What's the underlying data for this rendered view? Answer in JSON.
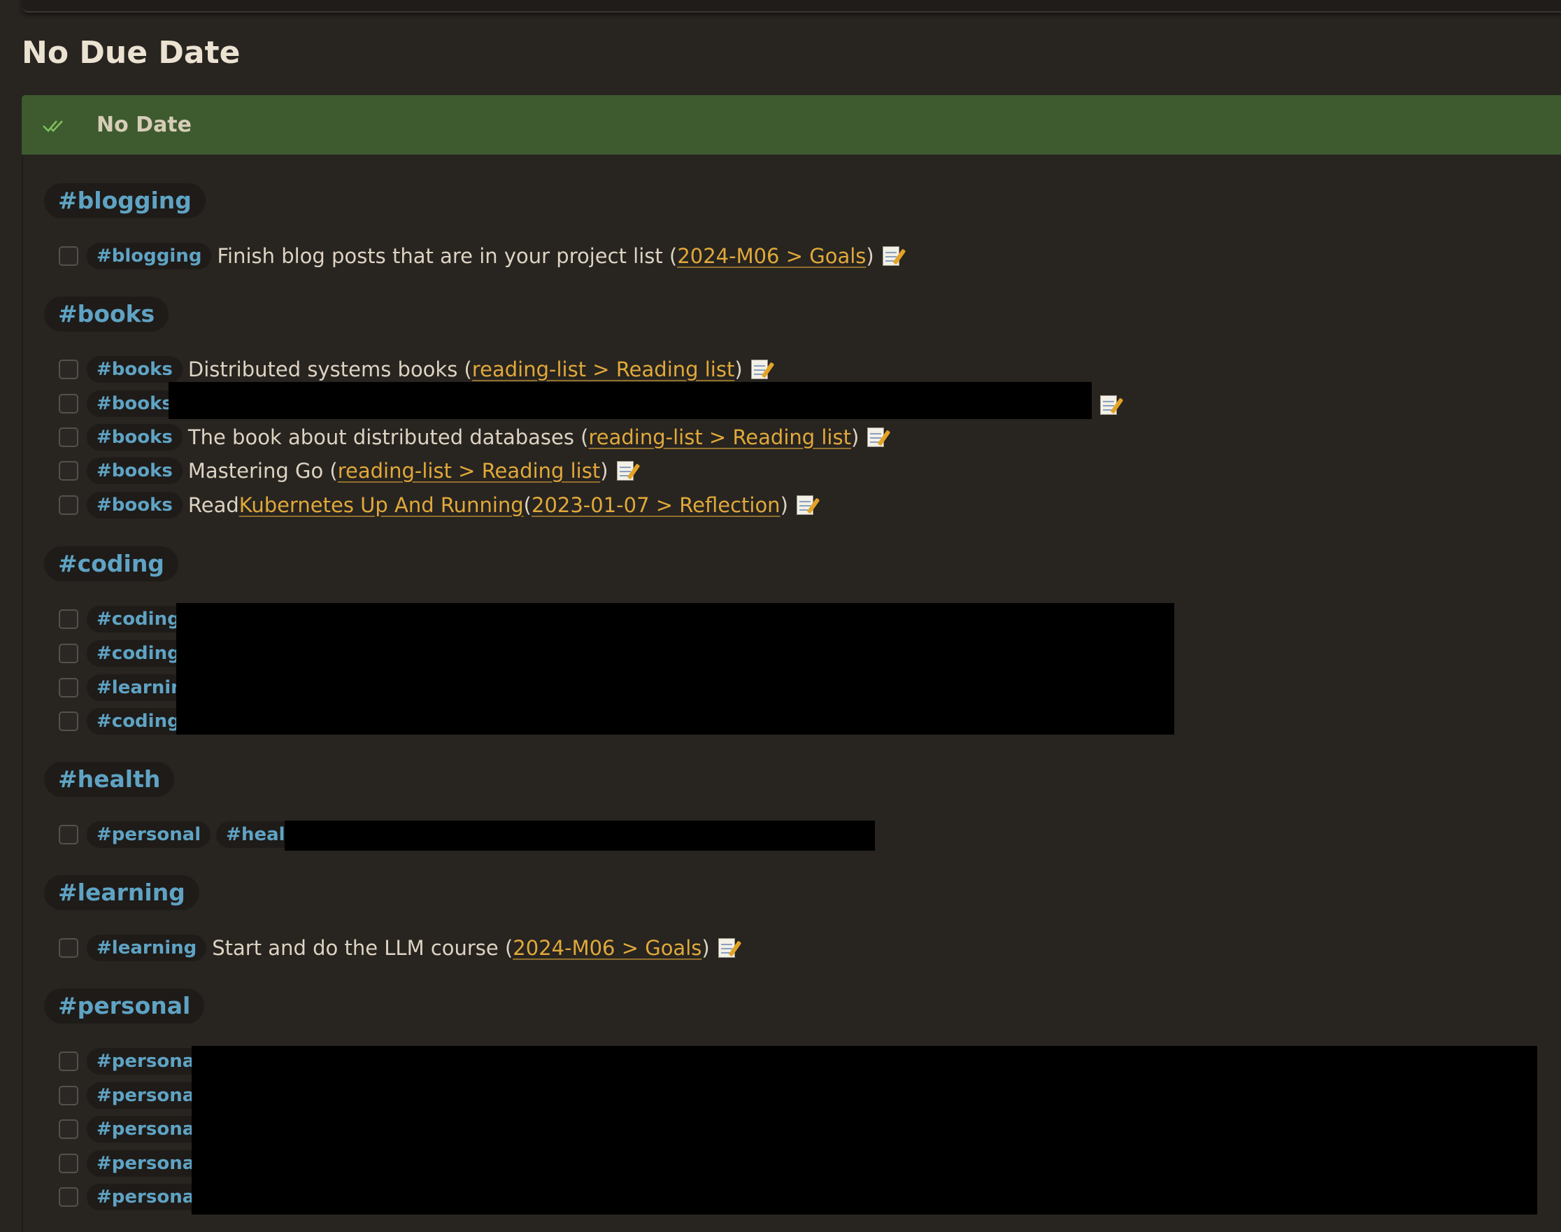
{
  "page": {
    "title": "No Due Date"
  },
  "callout": {
    "title": "No Date",
    "icon": "double-check-icon"
  },
  "groups": {
    "blogging": {
      "tag": "#blogging"
    },
    "books": {
      "tag": "#books"
    },
    "coding": {
      "tag": "#coding"
    },
    "health": {
      "tag": "#health"
    },
    "learning": {
      "tag": "#learning"
    },
    "personal": {
      "tag": "#personal"
    }
  },
  "tasks": {
    "blogging1": {
      "tag": "#blogging",
      "text": "Finish blog posts that are in your project list (",
      "link": "2024-M06 > Goals",
      "tail": ")"
    },
    "books1": {
      "tag": "#books",
      "text": "Distributed systems books (",
      "link": "reading-list > Reading list",
      "tail": ")"
    },
    "books2": {
      "tag": "#books"
    },
    "books3": {
      "tag": "#books",
      "text": "The book about distributed databases (",
      "link": "reading-list > Reading list",
      "tail": ")"
    },
    "books4": {
      "tag": "#books",
      "text": "Mastering Go (",
      "link": "reading-list > Reading list",
      "tail": ")"
    },
    "books5": {
      "tag": "#books",
      "text": "Read ",
      "link1": "Kubernetes Up And Running",
      "mid": " (",
      "link": "2023-01-07 > Reflection",
      "tail": ")"
    },
    "coding1": {
      "tag": "#coding"
    },
    "coding2": {
      "tag": "#coding"
    },
    "coding3": {
      "tag": "#learning"
    },
    "coding4": {
      "tag": "#coding"
    },
    "health1": {
      "tag1": "#personal",
      "tag2": "#health"
    },
    "learning1": {
      "tag": "#learning",
      "text": "Start and do the LLM course (",
      "link": "2024-M06 > Goals",
      "tail": ")"
    },
    "personal": [
      "#personal",
      "#personal",
      "#personal",
      "#personal",
      "#personal"
    ]
  },
  "colors": {
    "background": "#282420",
    "callout_header": "#3e5a2f",
    "tag_text": "#5fa3c4",
    "link": "#e0a93a",
    "check_icon": "#7fc05c"
  }
}
